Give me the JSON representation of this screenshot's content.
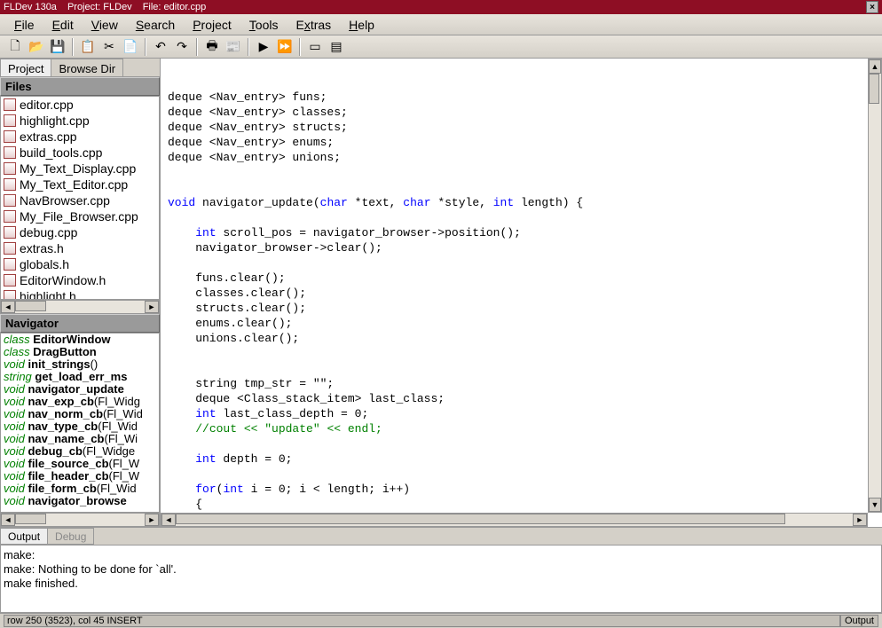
{
  "titlebar": {
    "app": "FLDev 130a",
    "project": "Project: FLDev",
    "file": "File: editor.cpp",
    "close": "×"
  },
  "menubar": [
    "File",
    "Edit",
    "View",
    "Search",
    "Project",
    "Tools",
    "Extras",
    "Help"
  ],
  "toolbar_icons": [
    {
      "name": "new-file-icon",
      "glyph": "🗋"
    },
    {
      "name": "open-file-icon",
      "glyph": "📂"
    },
    {
      "name": "save-file-icon",
      "glyph": "💾"
    },
    {
      "sep": true
    },
    {
      "name": "copy-icon",
      "glyph": "📋"
    },
    {
      "name": "cut-icon",
      "glyph": "✂"
    },
    {
      "name": "paste-icon",
      "glyph": "📄"
    },
    {
      "sep": true
    },
    {
      "name": "undo-icon",
      "glyph": "↶"
    },
    {
      "name": "redo-icon",
      "glyph": "↷"
    },
    {
      "sep": true
    },
    {
      "name": "print-icon",
      "glyph": "🖶"
    },
    {
      "name": "print-preview-icon",
      "glyph": "📰"
    },
    {
      "sep": true
    },
    {
      "name": "run-icon",
      "glyph": "▶"
    },
    {
      "name": "build-run-icon",
      "glyph": "⏩"
    },
    {
      "sep": true
    },
    {
      "name": "window-icon",
      "glyph": "▭"
    },
    {
      "name": "tile-icon",
      "glyph": "▤"
    }
  ],
  "left_tabs": {
    "a": "Project",
    "b": "Browse Dir"
  },
  "files_header": "Files",
  "files": [
    "editor.cpp",
    "highlight.cpp",
    "extras.cpp",
    "build_tools.cpp",
    "My_Text_Display.cpp",
    "My_Text_Editor.cpp",
    "NavBrowser.cpp",
    "My_File_Browser.cpp",
    "debug.cpp",
    "extras.h",
    "globals.h",
    "EditorWindow.h",
    "highlight.h"
  ],
  "nav_header": "Navigator",
  "navigator": [
    {
      "kw": "class",
      "nm": "EditorWindow",
      "ar": ""
    },
    {
      "kw": "class",
      "nm": "DragButton",
      "ar": ""
    },
    {
      "kw": "void",
      "nm": "init_strings",
      "ar": "()"
    },
    {
      "kw": "string",
      "nm": "get_load_err_ms",
      "ar": ""
    },
    {
      "kw": "void",
      "nm": "navigator_update",
      "ar": ""
    },
    {
      "kw": "void",
      "nm": "nav_exp_cb",
      "ar": "(Fl_Widg"
    },
    {
      "kw": "void",
      "nm": "nav_norm_cb",
      "ar": "(Fl_Wid"
    },
    {
      "kw": "void",
      "nm": "nav_type_cb",
      "ar": "(Fl_Wid"
    },
    {
      "kw": "void",
      "nm": "nav_name_cb",
      "ar": "(Fl_Wi"
    },
    {
      "kw": "void",
      "nm": "debug_cb",
      "ar": "(Fl_Widge"
    },
    {
      "kw": "void",
      "nm": "file_source_cb",
      "ar": "(Fl_W"
    },
    {
      "kw": "void",
      "nm": "file_header_cb",
      "ar": "(Fl_W"
    },
    {
      "kw": "void",
      "nm": "file_form_cb",
      "ar": "(Fl_Wid"
    },
    {
      "kw": "void",
      "nm": "navigator_browse",
      "ar": ""
    }
  ],
  "code_lines": [
    {
      "t": "deque <Nav_entry> funs;",
      "c": ""
    },
    {
      "t": "deque <Nav_entry> classes;",
      "c": ""
    },
    {
      "t": "deque <Nav_entry> structs;",
      "c": ""
    },
    {
      "t": "deque <Nav_entry> enums;",
      "c": ""
    },
    {
      "t": "deque <Nav_entry> unions;",
      "c": ""
    },
    {
      "t": "",
      "c": ""
    },
    {
      "t": "",
      "c": ""
    },
    {
      "html": "<span class='cb'>void</span> navigator_update(<span class='cb'>char</span> *text, <span class='cb'>char</span> *style, <span class='cb'>int</span> length) {"
    },
    {
      "t": "",
      "c": ""
    },
    {
      "html": "    <span class='cb'>int</span> scroll_pos = navigator_browser->position();"
    },
    {
      "t": "    navigator_browser->clear();",
      "c": ""
    },
    {
      "t": "",
      "c": ""
    },
    {
      "t": "    funs.clear();",
      "c": ""
    },
    {
      "t": "    classes.clear();",
      "c": ""
    },
    {
      "t": "    structs.clear();",
      "c": ""
    },
    {
      "t": "    enums.clear();",
      "c": ""
    },
    {
      "t": "    unions.clear();",
      "c": ""
    },
    {
      "t": "",
      "c": ""
    },
    {
      "t": "",
      "c": ""
    },
    {
      "t": "    string tmp_str = \"\";",
      "c": ""
    },
    {
      "t": "    deque <Class_stack_item> last_class;",
      "c": ""
    },
    {
      "html": "    <span class='cb'>int</span> last_class_depth = 0;"
    },
    {
      "html": "    <span class='cg'>//cout << \"update\" << endl;</span>"
    },
    {
      "t": "",
      "c": ""
    },
    {
      "html": "    <span class='cb'>int</span> depth = 0;"
    },
    {
      "t": "",
      "c": ""
    },
    {
      "html": "    <span class='cb'>for</span>(<span class='cb'>int</span> i = 0; i < length; i++)"
    },
    {
      "t": "    {",
      "c": ""
    }
  ],
  "bottom_tabs": {
    "a": "Output",
    "b": "Debug"
  },
  "output": {
    "l1": "make:",
    "l2": "make: Nothing to be done for `all'.",
    "l3": "make finished."
  },
  "statusbar": {
    "left": "row 250 (3523), col 45  INSERT",
    "right": "Output"
  }
}
